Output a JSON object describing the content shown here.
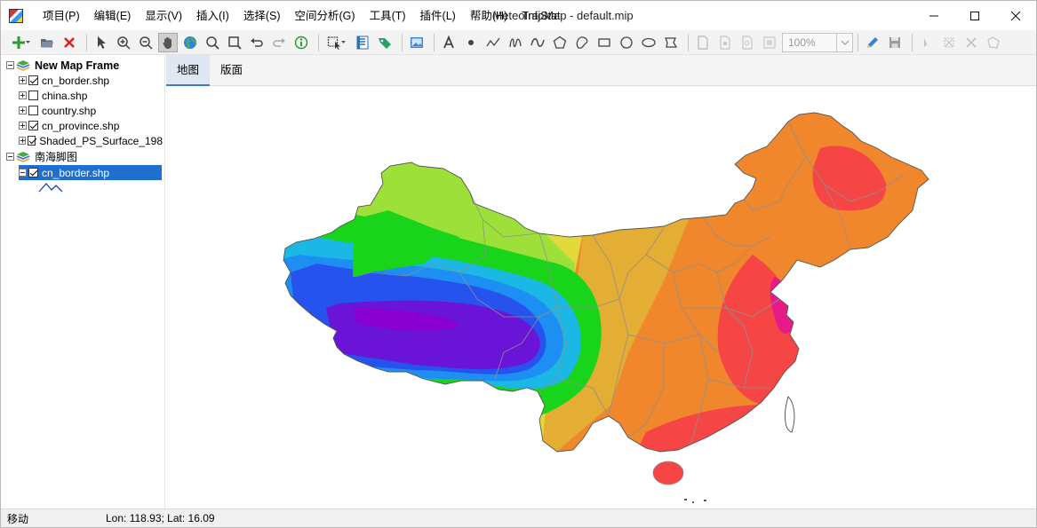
{
  "window": {
    "title": "MeteoInfoMap - default.mip"
  },
  "menu": {
    "items": [
      "项目(P)",
      "编辑(E)",
      "显示(V)",
      "插入(I)",
      "选择(S)",
      "空间分析(G)",
      "工具(T)",
      "插件(L)",
      "帮助(H)",
      "TrajStat"
    ]
  },
  "toolbar": {
    "zoom_value": "100%",
    "icons": [
      "add-layer-icon",
      "open-folder-icon",
      "remove-layer-icon",
      "select-pointer-icon",
      "zoom-in-icon",
      "zoom-out-icon",
      "pan-hand-icon",
      "full-extent-globe-icon",
      "magnifier-icon",
      "zoom-box-icon",
      "undo-icon",
      "redo-icon",
      "identify-info-icon",
      "select-shape-icon",
      "attribute-table-icon",
      "label-tag-icon",
      "image-icon",
      "text-icon",
      "point-icon",
      "polyline-icon",
      "freehand-line-icon",
      "curve-icon",
      "polygon-icon",
      "curve-polygon-icon",
      "rectangle-icon",
      "circle-icon",
      "ellipse-icon",
      "freehand-polygon-icon",
      "edit-pencil-icon",
      "save-icon"
    ]
  },
  "legend": {
    "frame1": {
      "name": "New Map Frame",
      "layers": [
        {
          "name": "cn_border.shp",
          "checked": true
        },
        {
          "name": "china.shp",
          "checked": false
        },
        {
          "name": "country.shp",
          "checked": false
        },
        {
          "name": "cn_province.shp",
          "checked": true
        },
        {
          "name": "Shaded_PS_Surface_198",
          "checked": true
        }
      ]
    },
    "frame2": {
      "name": "南海脚图",
      "layers": [
        {
          "name": "cn_border.shp",
          "checked": true
        }
      ]
    }
  },
  "tabs": [
    "地图",
    "版面"
  ],
  "map": {
    "colors": {
      "violet": "#8a00d0",
      "purple": "#6a14d8",
      "blue": "#2652ee",
      "mid_blue": "#1e8ff2",
      "cyan": "#1bb8e6",
      "green": "#18d41a",
      "light_green": "#9ee03a",
      "yellow": "#e3d93a",
      "amber": "#e4ad33",
      "orange": "#f0872c",
      "red": "#f64545",
      "magenta": "#e81a88",
      "boundary": "#8f8f8f"
    }
  },
  "status": {
    "mode": "移动",
    "coords": "Lon: 118.93; Lat: 16.09"
  }
}
